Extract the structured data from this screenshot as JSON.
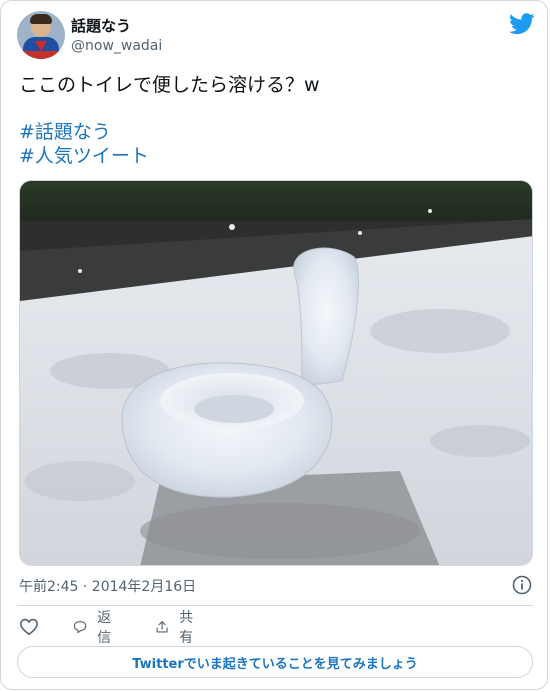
{
  "user": {
    "display_name": "話題なう",
    "handle": "@now_wadai"
  },
  "tweet": {
    "text": "ここのトイレで便したら溶ける？w",
    "hashtags": [
      "#話題なう",
      "#人気ツイート"
    ],
    "timestamp": "午前2:45 · 2014年2月16日"
  },
  "actions": {
    "reply_label": "返信",
    "share_label": "共有"
  },
  "cta_label": "Twitterでいま起きていることを見てみましょう",
  "icons": {
    "brand": "twitter-bird-icon",
    "info": "info-icon",
    "like": "heart-icon",
    "reply": "speech-bubble-icon",
    "share": "share-icon"
  },
  "colors": {
    "link": "#1b75c0",
    "brand": "#1d9bf0",
    "muted": "#536471",
    "border": "#cfd9de"
  }
}
